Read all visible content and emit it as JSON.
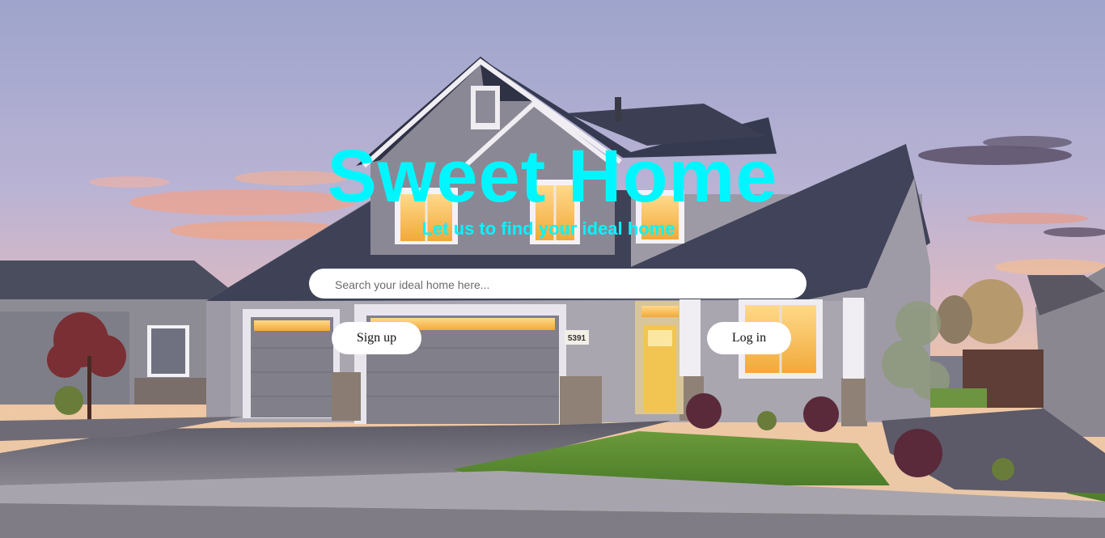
{
  "hero": {
    "title": "Sweet Home",
    "subtitle": "Let us to find your ideal home",
    "accent_color": "#00f6ff",
    "background": "photo of a suburban house at dusk"
  },
  "search": {
    "placeholder": "Search your ideal home here...",
    "value": ""
  },
  "actions": {
    "signup_label": "Sign up",
    "login_label": "Log in"
  },
  "house": {
    "number": "5391"
  }
}
